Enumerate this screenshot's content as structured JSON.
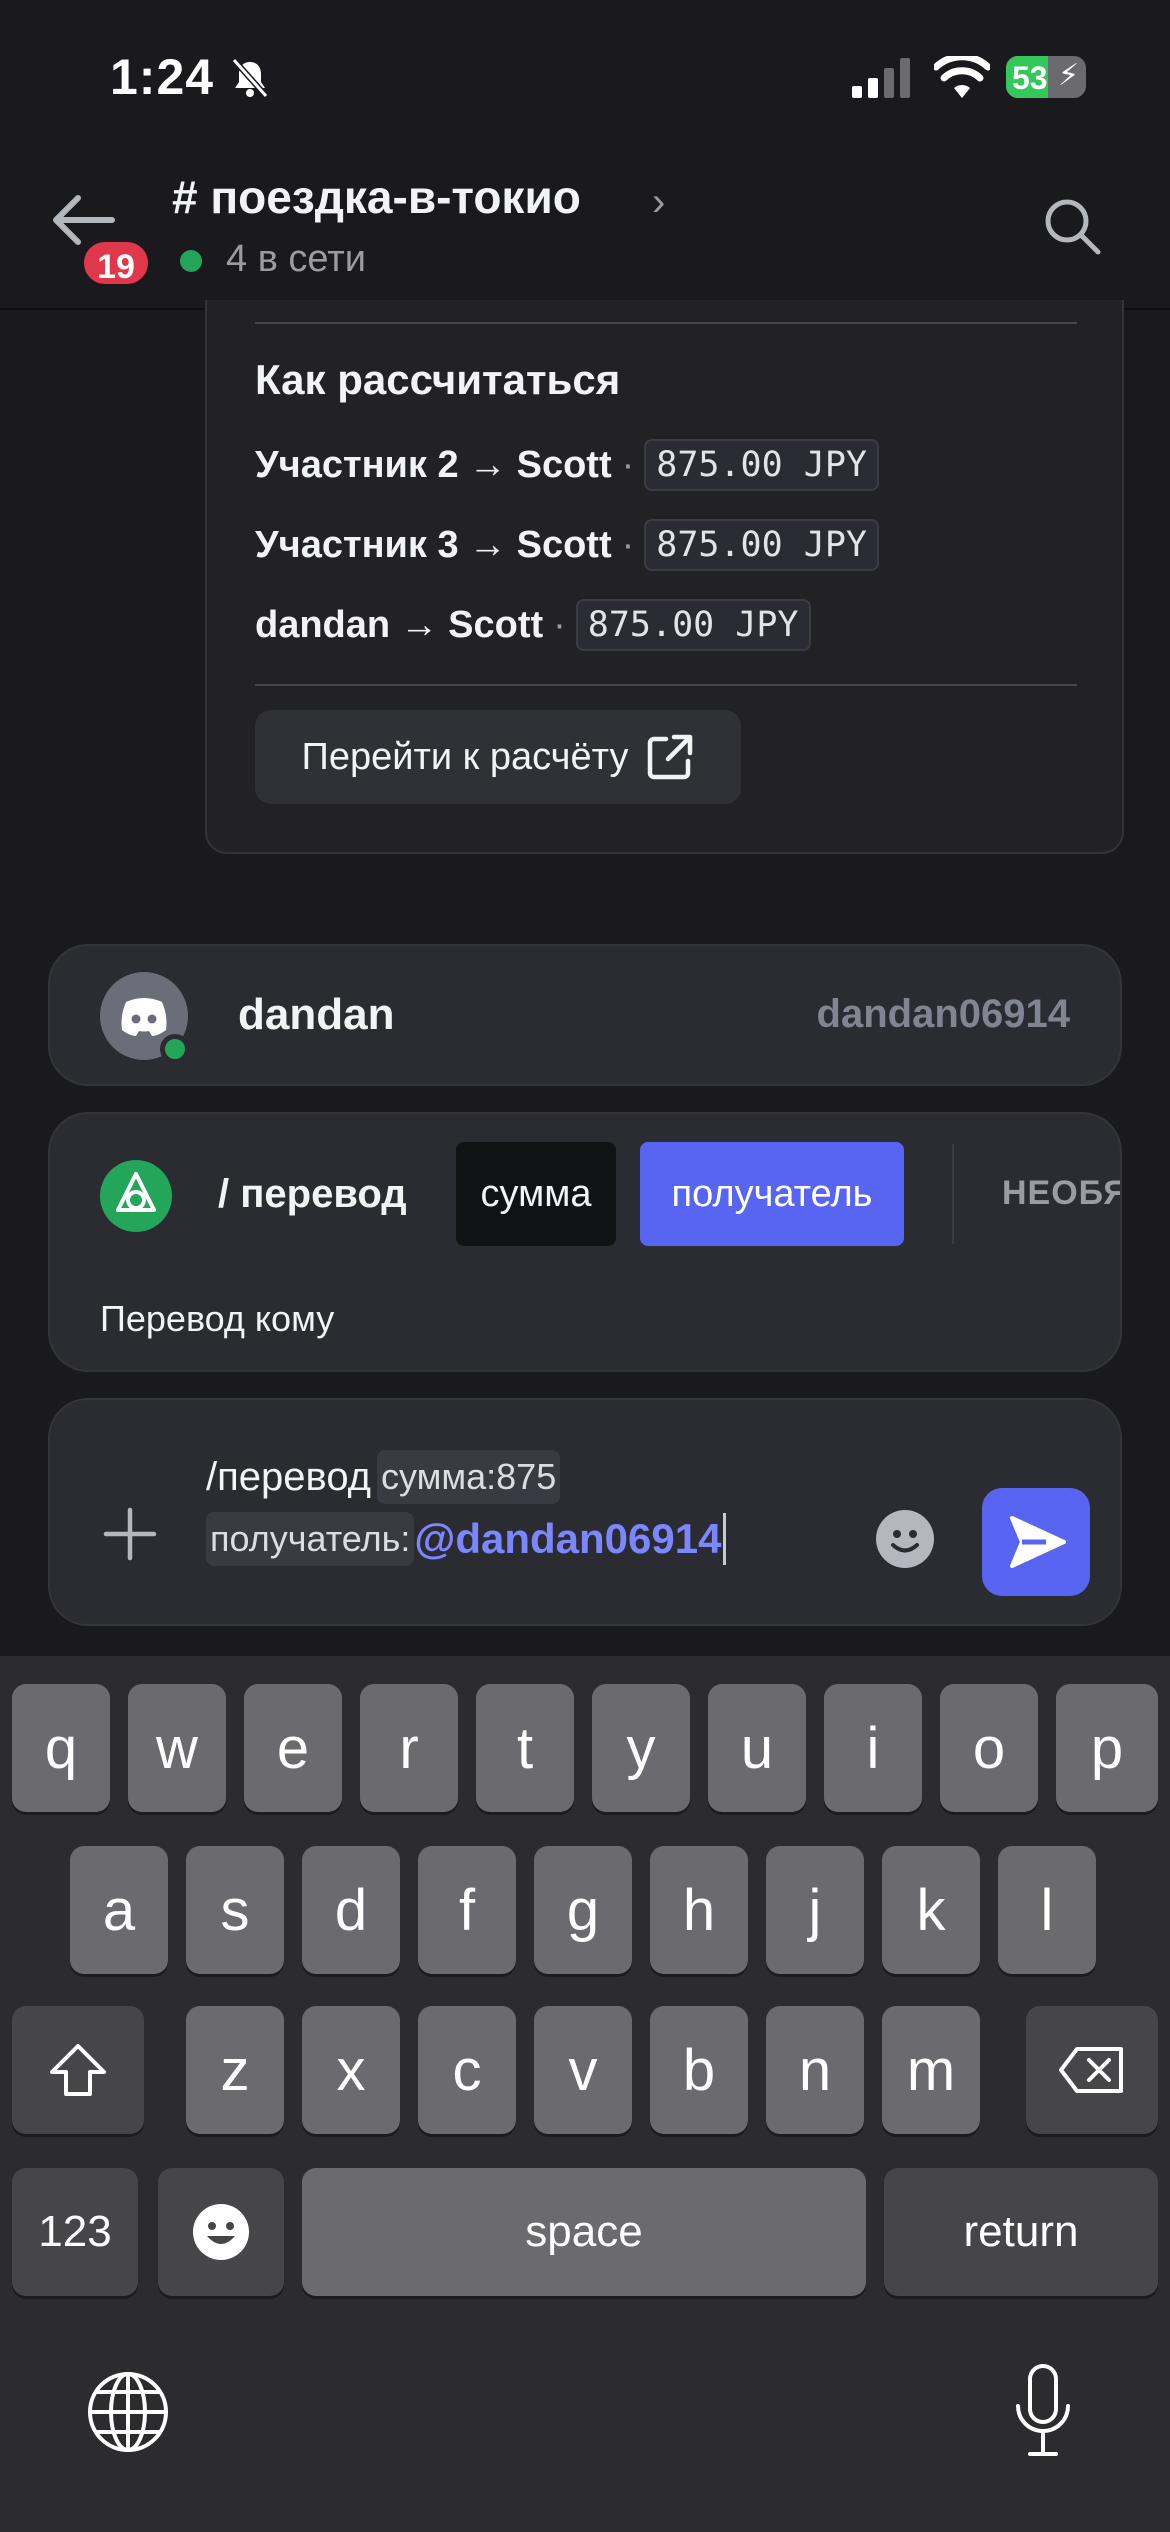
{
  "status_bar": {
    "time": "1:24",
    "battery": "53"
  },
  "header": {
    "unread_badge": "19",
    "channel_title": "# поездка-в-токио",
    "online_text": "4 в сети"
  },
  "embed": {
    "heading": "Как рассчитаться",
    "rows": [
      {
        "from": "Участник 2",
        "to": "Scott",
        "amount": "875.00 JPY"
      },
      {
        "from": "Участник 3",
        "to": "Scott",
        "amount": "875.00 JPY"
      },
      {
        "from": "dandan",
        "to": "Scott",
        "amount": "875.00 JPY"
      }
    ],
    "arrow": "→",
    "separator": "·",
    "button_label": "Перейти к расчёту"
  },
  "mention_suggestion": {
    "display_name": "dandan",
    "username": "dandan06914"
  },
  "command": {
    "name": "/ перевод",
    "options": [
      "сумма",
      "получатель"
    ],
    "selected_option": "получатель",
    "optional_label": "НЕОБЯ",
    "option_description": "Перевод кому"
  },
  "composer": {
    "command_text": "/перевод",
    "param1_label": "сумма:",
    "param1_value": "875",
    "param2_label": "получатель:",
    "param2_value": "@dandan06914"
  },
  "keyboard": {
    "row1": [
      "q",
      "w",
      "e",
      "r",
      "t",
      "y",
      "u",
      "i",
      "o",
      "p"
    ],
    "row2": [
      "a",
      "s",
      "d",
      "f",
      "g",
      "h",
      "j",
      "k",
      "l"
    ],
    "row3": [
      "z",
      "x",
      "c",
      "v",
      "b",
      "n",
      "m"
    ],
    "numbers_label": "123",
    "space_label": "space",
    "return_label": "return"
  },
  "colors": {
    "accent": "#5865f2",
    "online": "#23a55a",
    "badge": "#e0374a",
    "mention": "#7c87ff"
  }
}
